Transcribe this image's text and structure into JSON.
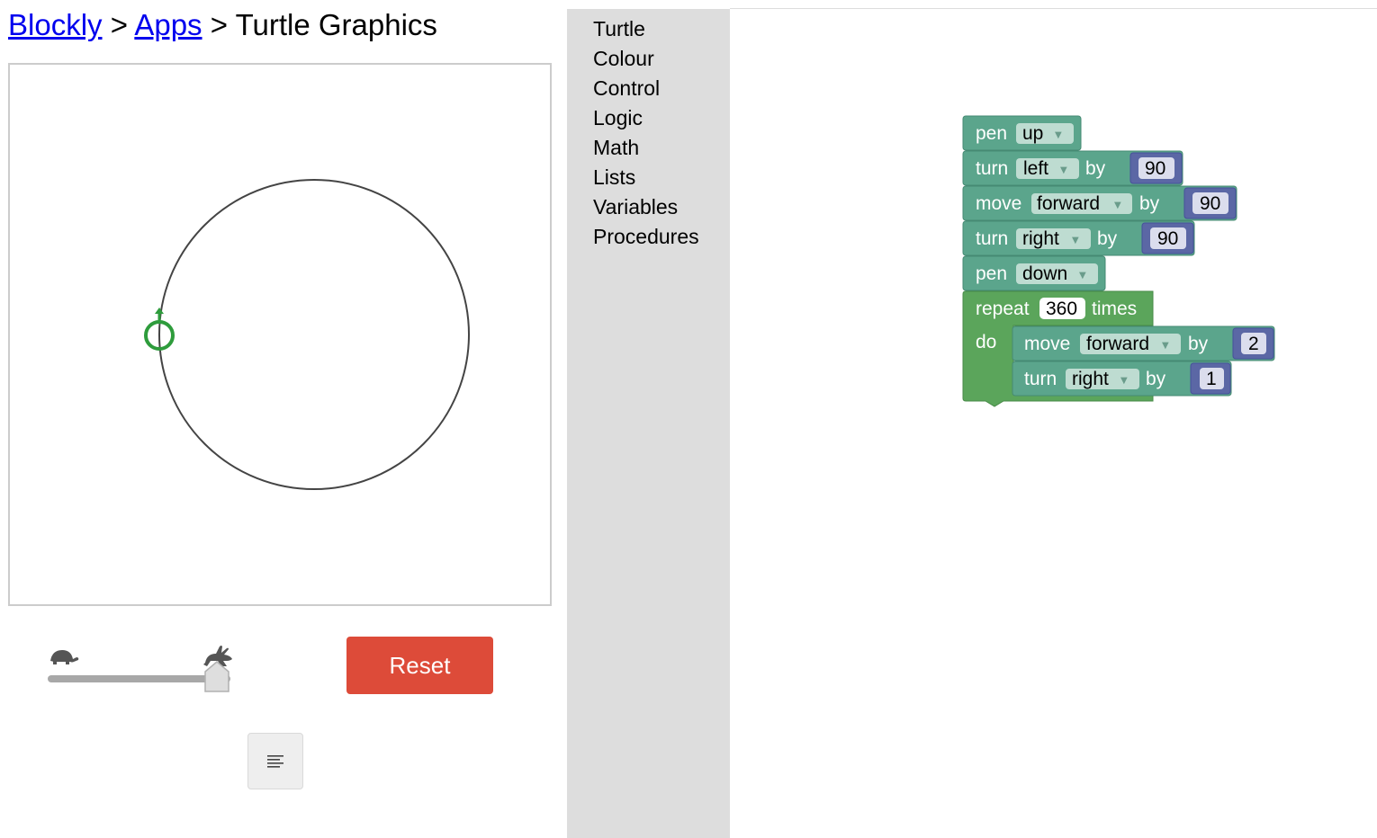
{
  "breadcrumb": {
    "link1": "Blockly",
    "sep1": " > ",
    "link2": "Apps",
    "sep2": " > ",
    "current": "Turtle Graphics"
  },
  "controls": {
    "reset_label": "Reset",
    "speed_level": 1.0
  },
  "toolbox": {
    "categories": [
      "Turtle",
      "Colour",
      "Control",
      "Logic",
      "Math",
      "Lists",
      "Variables",
      "Procedures"
    ]
  },
  "blocks": {
    "pen_up": {
      "kw": "pen",
      "dropdown": "up"
    },
    "turn_left": {
      "kw": "turn",
      "dropdown": "left",
      "by": "by",
      "value": "90"
    },
    "move_forward": {
      "kw": "move",
      "dropdown": "forward",
      "by": "by",
      "value": "90"
    },
    "turn_right": {
      "kw": "turn",
      "dropdown": "right",
      "by": "by",
      "value": "90"
    },
    "pen_down": {
      "kw": "pen",
      "dropdown": "down"
    },
    "repeat": {
      "kw": "repeat",
      "count": "360",
      "times": "times",
      "do": "do"
    },
    "inner_move": {
      "kw": "move",
      "dropdown": "forward",
      "by": "by",
      "value": "2"
    },
    "inner_turn": {
      "kw": "turn",
      "dropdown": "right",
      "by": "by",
      "value": "1"
    }
  },
  "colors": {
    "turtle_block": "#5ba58c",
    "loop_block": "#5ba55b",
    "math_block": "#5b67a5",
    "reset": "#dd4b39",
    "turtle_marker": "#2e9c3c"
  },
  "icons": {
    "slow": "turtle-icon",
    "fast": "rabbit-icon",
    "code": "code-lines-icon"
  }
}
